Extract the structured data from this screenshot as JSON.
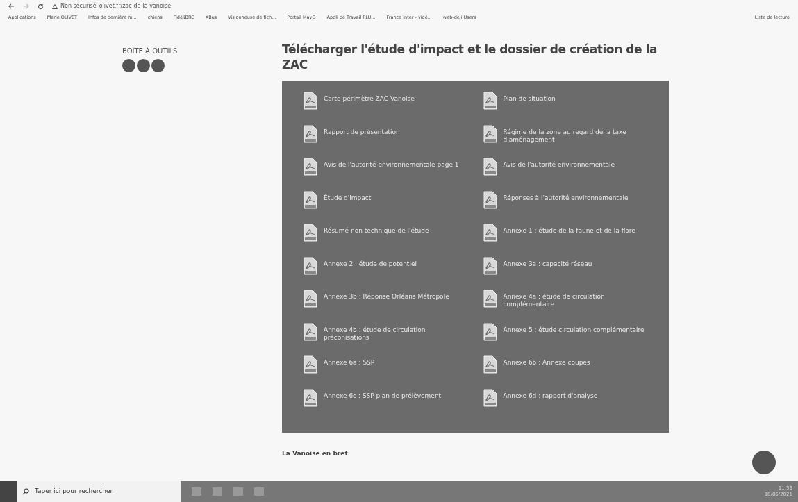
{
  "browser": {
    "address_prefix": "Non sécurisé",
    "url": "olivet.fr/zac-de-la-vanoise",
    "bookmarks": [
      "Applications",
      "Marie OLIVET",
      "Infos de dernière m...",
      "chiens",
      "FidéliBRC",
      "XBus",
      "Visionneuse de fich...",
      "Portail MayO",
      "Appli de Travail PLU...",
      "France Inter - vidé...",
      "web-deli Users"
    ],
    "reading_list": "Liste de lecture"
  },
  "sidebar": {
    "title": "BOÎTE À OUTILS"
  },
  "main": {
    "heading": "Télécharger l'étude d'impact et le dossier de création de la ZAC",
    "documents": [
      {
        "label": "Carte périmètre ZAC Vanoise"
      },
      {
        "label": "Plan de situation"
      },
      {
        "label": "Rapport de présentation"
      },
      {
        "label": "Régime de la zone au regard de la taxe d'aménagement"
      },
      {
        "label": "Avis de l'autorité environnementale page 1"
      },
      {
        "label": "Avis de l'autorité environnementale"
      },
      {
        "label": "Étude d'impact"
      },
      {
        "label": "Réponses à l'autorité environnementale"
      },
      {
        "label": "Résumé non technique de l'étude"
      },
      {
        "label": "Annexe 1 : étude de la faune et de la flore"
      },
      {
        "label": "Annexe 2 : étude de potentiel"
      },
      {
        "label": "Annexe 3a : capacité réseau"
      },
      {
        "label": "Annexe 3b : Réponse Orléans Métropole"
      },
      {
        "label": "Annexe 4a : étude de circulation complémentaire"
      },
      {
        "label": "Annexe 4b : étude de circulation préconisations"
      },
      {
        "label": "Annexe 5 : étude circulation complémentaire"
      },
      {
        "label": "Annexe 6a : SSP"
      },
      {
        "label": "Annexe 6b : Annexe coupes"
      },
      {
        "label": "Annexe 6c : SSP plan de prélèvement"
      },
      {
        "label": "Annexe 6d : rapport d'analyse"
      }
    ],
    "next_heading": "La Vanoise en bref"
  },
  "taskbar": {
    "search_placeholder": "Taper ici pour rechercher",
    "time": "11:33",
    "date": "10/06/2021"
  }
}
